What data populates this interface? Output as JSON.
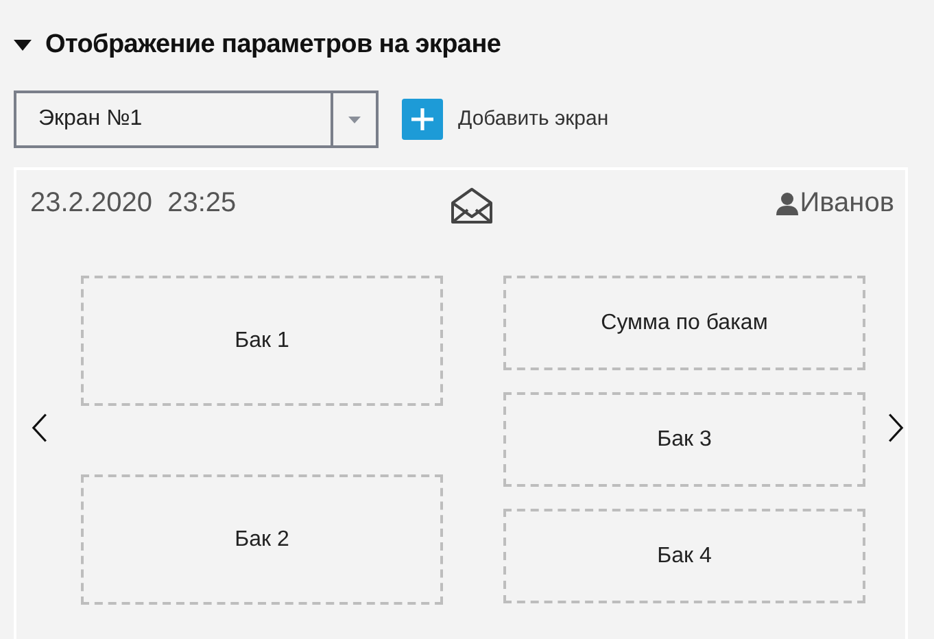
{
  "section": {
    "title": "Отображение параметров на экране",
    "expanded": true
  },
  "screen_select": {
    "value": "Экран №1"
  },
  "add_button": {
    "label": "Добавить экран"
  },
  "preview": {
    "date": "23.2.2020",
    "time": "23:25",
    "user": "Иванов",
    "left_column": [
      "Бак 1",
      "Бак 2"
    ],
    "right_column": [
      "Сумма по бакам",
      "Бак 3",
      "Бак 4"
    ]
  }
}
